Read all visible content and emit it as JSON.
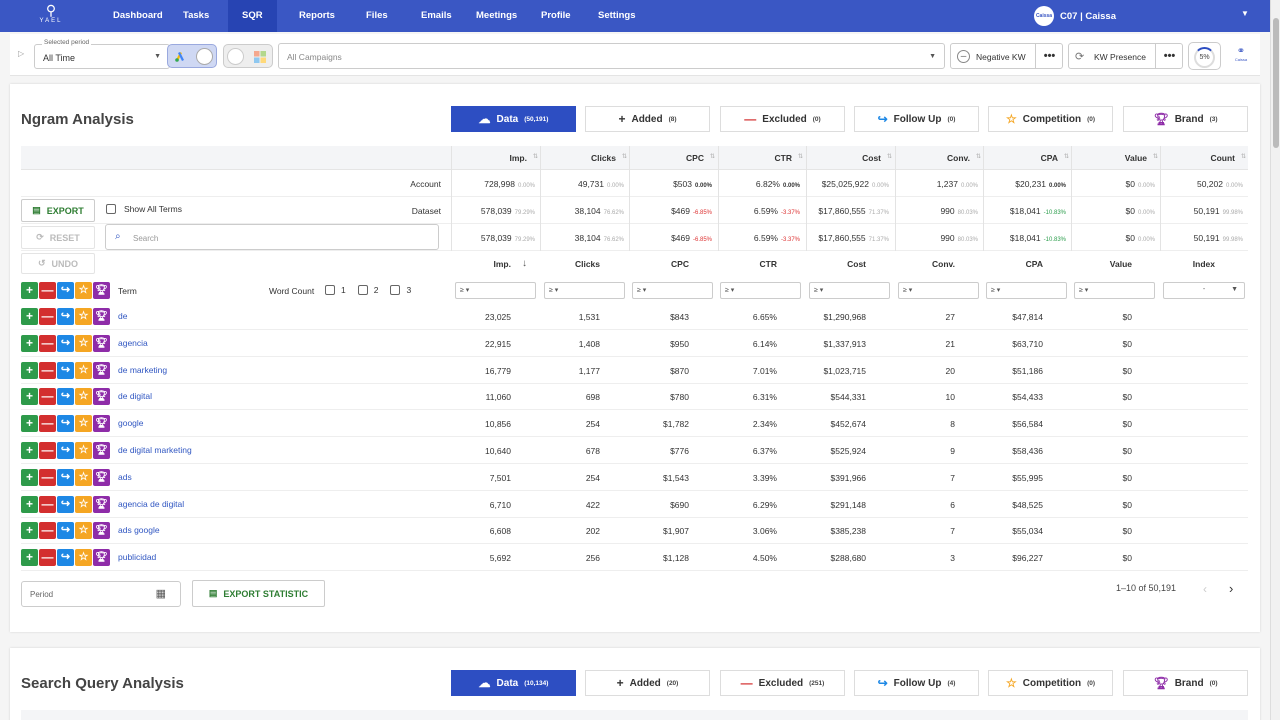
{
  "nav": {
    "logo_text": "YAEL",
    "items": [
      "Dashboard",
      "Tasks",
      "SQR",
      "Reports",
      "Files",
      "Emails",
      "Meetings",
      "Profile",
      "Settings"
    ],
    "active": "SQR",
    "account_label": "C07 | Caissa",
    "avatar_text": "Caissa"
  },
  "filters": {
    "period_label": "Selected period",
    "period_value": "All Time",
    "campaign_placeholder": "All Campaigns",
    "negative_kw": "Negative KW",
    "kw_presence": "KW Presence",
    "progress": "5%",
    "logo_text": "Caissa"
  },
  "ngram": {
    "title": "Ngram Analysis",
    "tabs": [
      {
        "label": "Data",
        "count": "(50,191)"
      },
      {
        "label": "Added",
        "count": "(8)"
      },
      {
        "label": "Excluded",
        "count": "(0)"
      },
      {
        "label": "Follow Up",
        "count": "(0)"
      },
      {
        "label": "Competition",
        "count": "(0)"
      },
      {
        "label": "Brand",
        "count": "(3)"
      }
    ],
    "summary_headers": [
      "Imp.",
      "Clicks",
      "CPC",
      "CTR",
      "Cost",
      "Conv.",
      "CPA",
      "Value",
      "Count"
    ],
    "summary_rows": [
      {
        "label": "Account",
        "cells": [
          [
            "728,998",
            "0.00%"
          ],
          [
            "49,731",
            "0.00%"
          ],
          [
            "$503",
            "0.00%"
          ],
          [
            "6.82%",
            "0.00%"
          ],
          [
            "$25,025,922",
            "0.00%"
          ],
          [
            "1,237",
            "0.00%"
          ],
          [
            "$20,231",
            "0.00%"
          ],
          [
            "$0",
            "0.00%"
          ],
          [
            "50,202",
            "0.00%"
          ]
        ]
      },
      {
        "label": "Dataset",
        "cells": [
          [
            "578,039",
            "79.29%"
          ],
          [
            "38,104",
            "76.62%"
          ],
          [
            "$469",
            "-6.85%"
          ],
          [
            "6.59%",
            "-3.37%"
          ],
          [
            "$17,860,555",
            "71.37%"
          ],
          [
            "990",
            "80.03%"
          ],
          [
            "$18,041",
            "-10.83%"
          ],
          [
            "$0",
            "0.00%"
          ],
          [
            "50,191",
            "99.98%"
          ]
        ]
      },
      {
        "label": "",
        "cells": [
          [
            "578,039",
            "79.29%"
          ],
          [
            "38,104",
            "76.62%"
          ],
          [
            "$469",
            "-6.85%"
          ],
          [
            "6.59%",
            "-3.37%"
          ],
          [
            "$17,860,555",
            "71.37%"
          ],
          [
            "990",
            "80.03%"
          ],
          [
            "$18,041",
            "-10.83%"
          ],
          [
            "$0",
            "0.00%"
          ],
          [
            "50,191",
            "99.98%"
          ]
        ]
      }
    ],
    "export": "EXPORT",
    "show_all_terms": "Show All Terms",
    "reset": "RESET",
    "undo": "UNDO",
    "search_placeholder": "Search",
    "term_header": "Term",
    "word_count": "Word Count",
    "wc_options": [
      "1",
      "2",
      "3"
    ],
    "detail_headers": [
      "Imp.",
      "Clicks",
      "CPC",
      "CTR",
      "Cost",
      "Conv.",
      "CPA",
      "Value",
      "Index"
    ],
    "filter_symbol": "≥",
    "index_select": "-",
    "rows": [
      {
        "term": "de",
        "v": [
          "23,025",
          "1,531",
          "$843",
          "6.65%",
          "$1,290,968",
          "27",
          "$47,814",
          "$0"
        ]
      },
      {
        "term": "agencia",
        "v": [
          "22,915",
          "1,408",
          "$950",
          "6.14%",
          "$1,337,913",
          "21",
          "$63,710",
          "$0"
        ]
      },
      {
        "term": "de marketing",
        "v": [
          "16,779",
          "1,177",
          "$870",
          "7.01%",
          "$1,023,715",
          "20",
          "$51,186",
          "$0"
        ]
      },
      {
        "term": "de digital",
        "v": [
          "11,060",
          "698",
          "$780",
          "6.31%",
          "$544,331",
          "10",
          "$54,433",
          "$0"
        ]
      },
      {
        "term": "google",
        "v": [
          "10,856",
          "254",
          "$1,782",
          "2.34%",
          "$452,674",
          "8",
          "$56,584",
          "$0"
        ]
      },
      {
        "term": "de digital marketing",
        "v": [
          "10,640",
          "678",
          "$776",
          "6.37%",
          "$525,924",
          "9",
          "$58,436",
          "$0"
        ]
      },
      {
        "term": "ads",
        "v": [
          "7,501",
          "254",
          "$1,543",
          "3.39%",
          "$391,966",
          "7",
          "$55,995",
          "$0"
        ]
      },
      {
        "term": "agencia de digital",
        "v": [
          "6,710",
          "422",
          "$690",
          "6.29%",
          "$291,148",
          "6",
          "$48,525",
          "$0"
        ]
      },
      {
        "term": "ads google",
        "v": [
          "6,608",
          "202",
          "$1,907",
          "3.06%",
          "$385,238",
          "7",
          "$55,034",
          "$0"
        ]
      },
      {
        "term": "publicidad",
        "v": [
          "5,692",
          "256",
          "$1,128",
          "4.50%",
          "$288,680",
          "3",
          "$96,227",
          "$0"
        ]
      }
    ],
    "period_placeholder": "Period",
    "export_statistic": "EXPORT STATISTIC",
    "pagination": "1–10 of 50,191"
  },
  "sqa": {
    "title": "Search Query Analysis",
    "tabs": [
      {
        "label": "Data",
        "count": "(10,134)"
      },
      {
        "label": "Added",
        "count": "(20)"
      },
      {
        "label": "Excluded",
        "count": "(251)"
      },
      {
        "label": "Follow Up",
        "count": "(4)"
      },
      {
        "label": "Competition",
        "count": "(0)"
      },
      {
        "label": "Brand",
        "count": "(0)"
      }
    ]
  },
  "colors": {
    "nav": "#3a57c4",
    "primary": "#2d4ec2",
    "add": "#2e9a4a",
    "exclude": "#d32f2f",
    "follow": "#1e88e5",
    "competition": "#f5a623",
    "brand": "#8e2ca8"
  }
}
